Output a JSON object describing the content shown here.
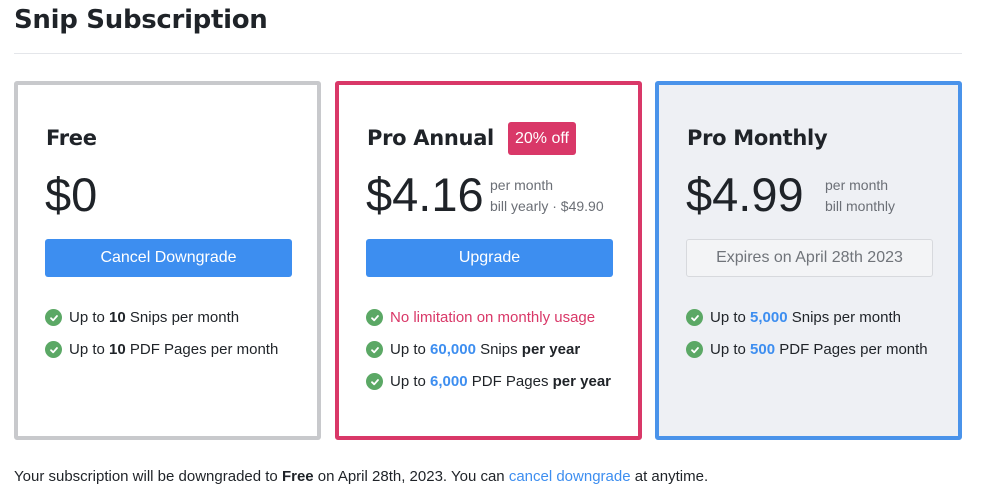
{
  "page": {
    "title": "Snip Subscription"
  },
  "plans": {
    "free": {
      "name": "Free",
      "price": "$0",
      "button": "Cancel Downgrade",
      "features": [
        {
          "a": "Up to ",
          "b": "10",
          "c": " Snips per month"
        },
        {
          "a": "Up to ",
          "b": "10",
          "c": " PDF Pages per month"
        }
      ]
    },
    "annual": {
      "name": "Pro Annual",
      "badge": "20% off",
      "price": "$4.16",
      "note1": "per month",
      "note2": "bill yearly · $49.90",
      "button": "Upgrade",
      "f0": "No limitation on monthly usage",
      "features": [
        {
          "a": "Up to ",
          "b": "60,000",
          "c": " Snips ",
          "d": "per year"
        },
        {
          "a": "Up to ",
          "b": "6,000",
          "c": " PDF Pages ",
          "d": "per year"
        }
      ]
    },
    "monthly": {
      "name": "Pro Monthly",
      "price": "$4.99",
      "note1": "per month",
      "note2": "bill monthly",
      "button": "Expires on April 28th 2023",
      "features": [
        {
          "a": "Up to ",
          "b": "5,000",
          "c": " Snips per month"
        },
        {
          "a": "Up to ",
          "b": "500",
          "c": " PDF Pages per month"
        }
      ]
    }
  },
  "footer": {
    "t1": "Your subscription will be downgraded to ",
    "plan": "Free",
    "t2": " on April 28th, 2023. You can ",
    "link": "cancel downgrade",
    "t3": " at anytime."
  },
  "colors": {
    "accent": "#3d8ef0",
    "pink": "#d93868",
    "check": "#5ba865"
  },
  "icons": {
    "feature": "check-circle-icon"
  }
}
